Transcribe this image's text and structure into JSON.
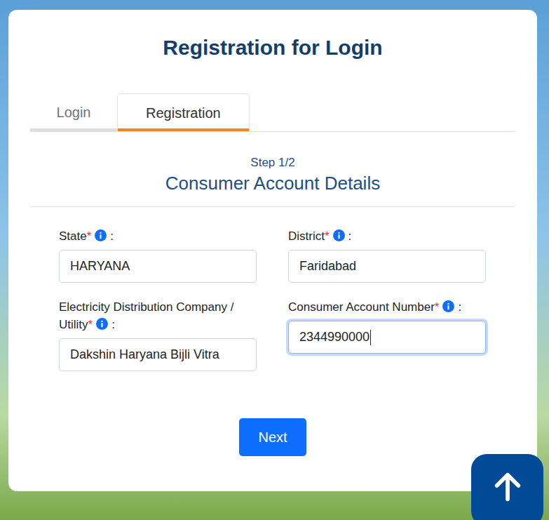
{
  "page": {
    "title": "Registration for Login"
  },
  "tabs": [
    {
      "label": "Login",
      "selected": false
    },
    {
      "label": "Registration",
      "selected": true
    }
  ],
  "step": "Step 1/2",
  "section": {
    "title": "Consumer Account Details"
  },
  "fields": [
    {
      "label": "State",
      "required": true,
      "required_mark": "*",
      "separator": ":",
      "value": "HARYANA",
      "focused": false
    },
    {
      "label": "District",
      "required": true,
      "required_mark": "*",
      "separator": ":",
      "value": "Faridabad",
      "focused": false
    },
    {
      "label": "Electricity Distribution Company / Utility",
      "required": true,
      "required_mark": "*",
      "separator": ":",
      "value": "Dakshin Haryana Bijli Vitra",
      "focused": false
    },
    {
      "label": "Consumer Account Number",
      "required": true,
      "required_mark": "*",
      "separator": ":",
      "value": "2344990000",
      "focused": true
    }
  ],
  "buttons": [
    "Next"
  ]
}
